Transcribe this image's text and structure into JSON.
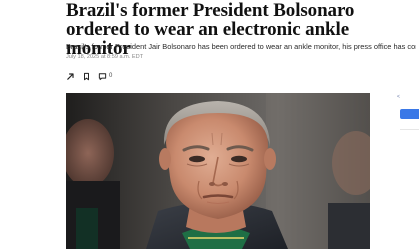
{
  "article": {
    "headline": "Brazil's former President Bolsonaro ordered to wear an electronic ankle monitor",
    "subheadline": "Brazil's former President Jair Bolsonaro has been ordered to wear an ankle monitor, his press office has confirmed",
    "timestamp": "July 18, 2025 at 8:59 a.m. EDT",
    "comment_count": "0"
  },
  "actions": [
    {
      "icon": "share-icon"
    },
    {
      "icon": "bookmark-icon"
    },
    {
      "icon": "comment-icon"
    }
  ],
  "right_rail": {
    "label": "<"
  },
  "colors": {
    "headline": "#111111",
    "timestamp": "#8a8a8a",
    "rail_button": "#3a78e7"
  }
}
